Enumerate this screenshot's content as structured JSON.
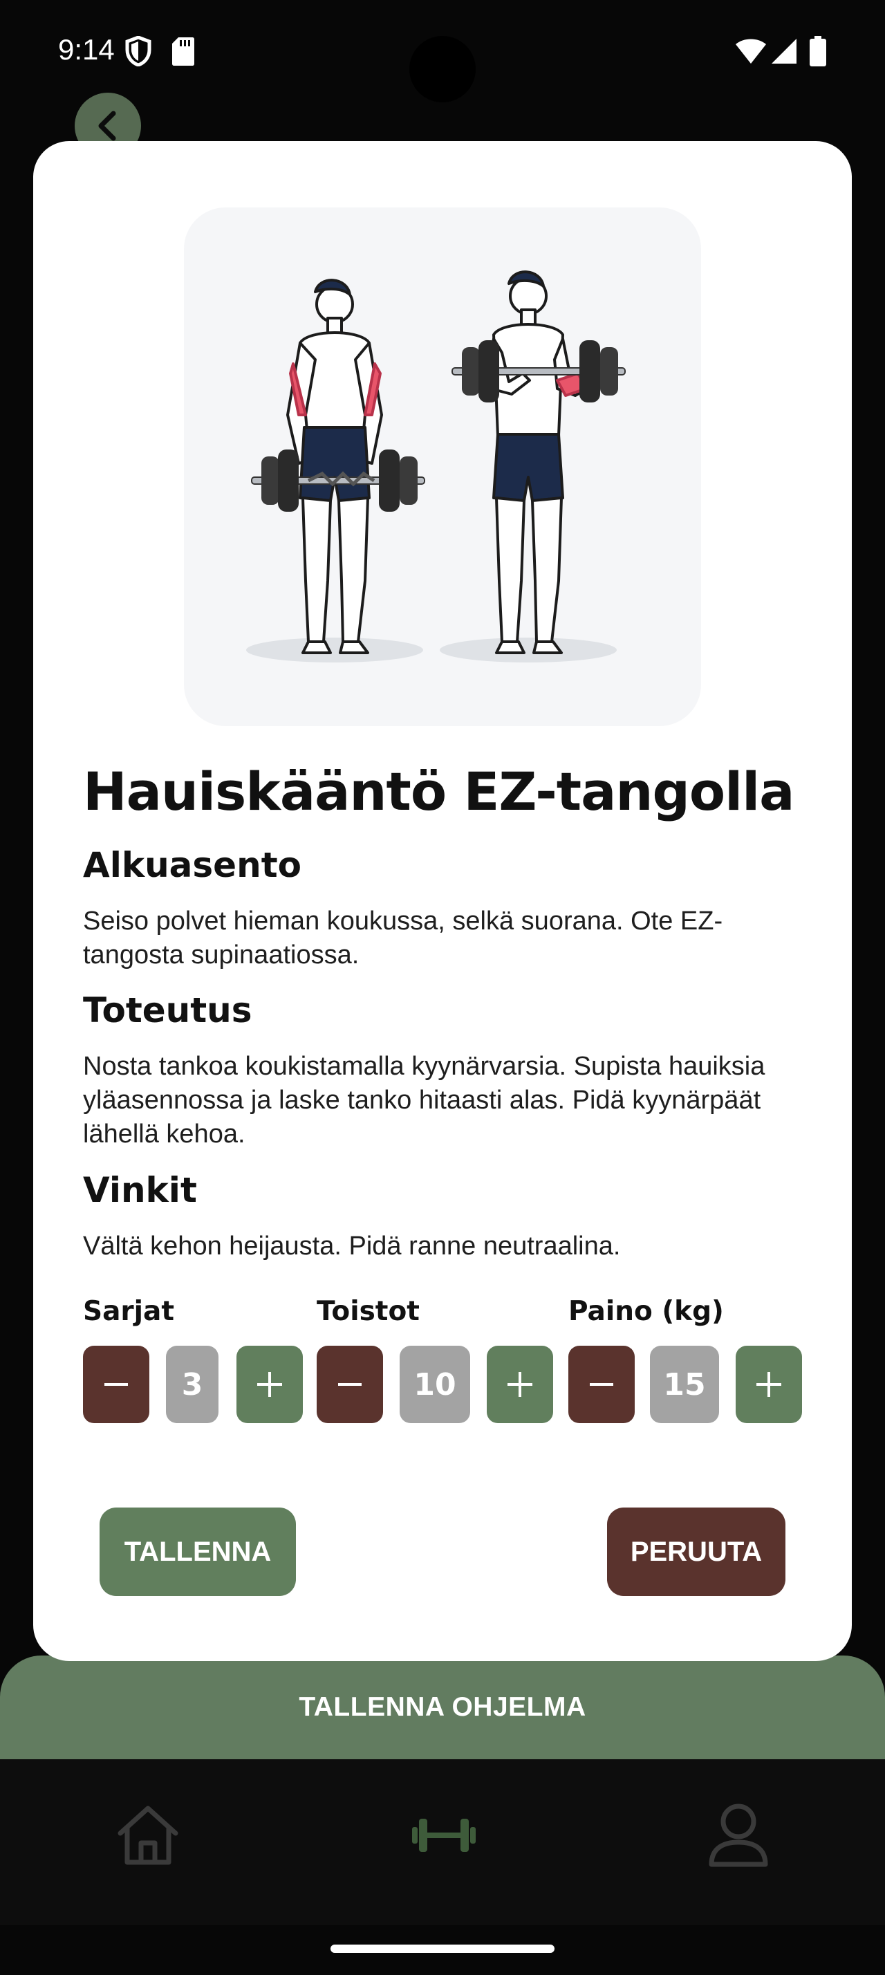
{
  "status_bar": {
    "time": "9:14",
    "icons": [
      "shield-icon",
      "sd-card-icon",
      "wifi-icon",
      "signal-icon",
      "battery-icon"
    ]
  },
  "background": {
    "back_button_icon": "chevron-left-icon",
    "save_program_label": "TALLENNA OHJELMA",
    "nav_items": [
      "home-icon",
      "dumbbell-icon",
      "profile-icon"
    ],
    "accent_color": "#627c60"
  },
  "modal": {
    "title": "Hauiskääntö EZ-tangolla",
    "sections": [
      {
        "heading": "Alkuasento",
        "text": "Seiso polvet hieman koukussa, selkä suorana. Ote EZ-tangosta supinaatiossa."
      },
      {
        "heading": "Toteutus",
        "text": "Nosta tankoa koukistamalla kyynärvarsia. Supista hauiksia yläasennossa ja laske tanko hitaasti alas. Pidä kyynärpäät lähellä kehoa."
      },
      {
        "heading": "Vinkit",
        "text": "Vältä kehon heijausta. Pidä ranne neutraalina."
      }
    ],
    "steppers": [
      {
        "label": "Sarjat",
        "value": "3"
      },
      {
        "label": "Toistot",
        "value": "10"
      },
      {
        "label": "Paino (kg)",
        "value": "15"
      }
    ],
    "save_label": "TALLENNA",
    "cancel_label": "PERUUTA",
    "colors": {
      "plus": "#617f5d",
      "minus": "#5a332d",
      "value_bg": "#a3a3a3",
      "save": "#617f5d",
      "cancel": "#5a332d"
    }
  }
}
